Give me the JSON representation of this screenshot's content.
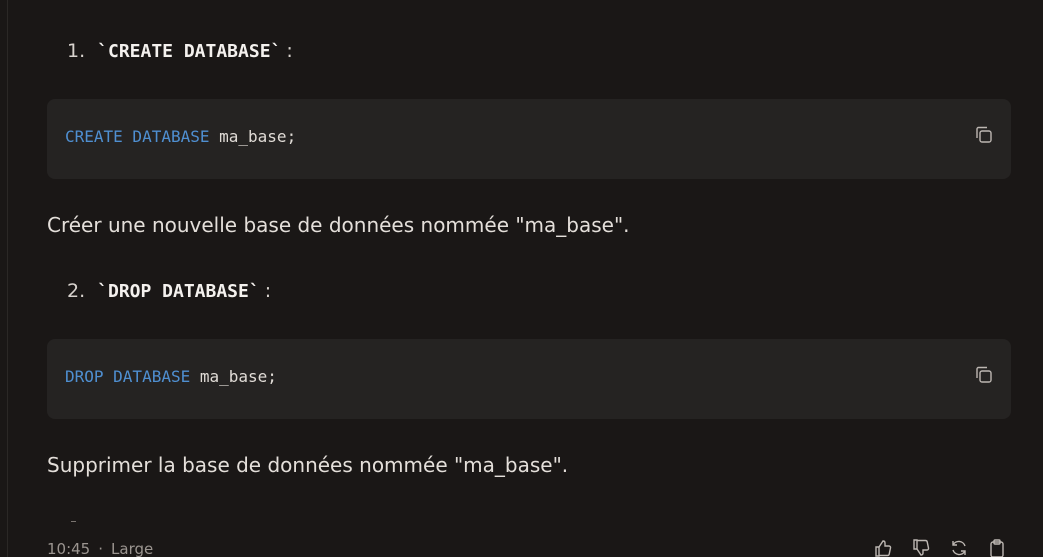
{
  "items": [
    {
      "number": "1.",
      "command": "`CREATE DATABASE`",
      "colon": ":",
      "code_keyword": "CREATE DATABASE",
      "code_rest": " ma_base;",
      "description": "Créer une nouvelle base de données nommée \"ma_base\"."
    },
    {
      "number": "2.",
      "command": "`DROP DATABASE`",
      "colon": ":",
      "code_keyword": "DROP DATABASE",
      "code_rest": " ma_base;",
      "description": "Supprimer la base de données nommée \"ma_base\"."
    }
  ],
  "footer": {
    "time": "10:45",
    "separator": "·",
    "model": "Large"
  },
  "icons": {
    "copy": "copy-icon",
    "thumbs_up": "thumbs-up-icon",
    "thumbs_down": "thumbs-down-icon",
    "regenerate": "regenerate-icon",
    "clipboard": "clipboard-icon"
  },
  "colors": {
    "background": "#1a1716",
    "code_background": "#252322",
    "keyword": "#4f8fd1"
  }
}
